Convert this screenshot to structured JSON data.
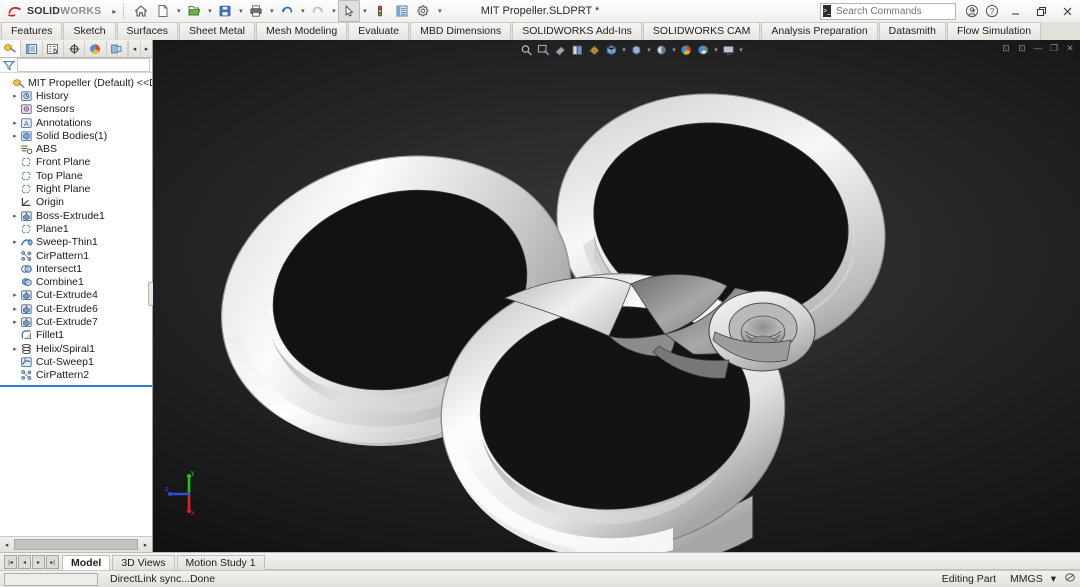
{
  "app": {
    "brand_ds": "3DS",
    "brand_name": "SOLIDWORKS",
    "brand_suffix": "WORKS",
    "document_title": "MIT Propeller.SLDPRT *"
  },
  "quick_access": [
    {
      "name": "home-icon",
      "label": "Home"
    },
    {
      "name": "new-document-icon",
      "label": "New"
    },
    {
      "name": "open-document-icon",
      "label": "Open"
    },
    {
      "name": "save-icon",
      "label": "Save"
    },
    {
      "name": "print-icon",
      "label": "Print"
    },
    {
      "name": "undo-icon",
      "label": "Undo"
    },
    {
      "name": "redo-icon",
      "label": "Redo"
    },
    {
      "name": "select-cursor-icon",
      "label": "Select"
    },
    {
      "name": "rebuild-icon",
      "label": "Rebuild"
    },
    {
      "name": "options-list-icon",
      "label": "Toggle Display"
    },
    {
      "name": "gear-icon",
      "label": "Options"
    }
  ],
  "search": {
    "placeholder": "Search Commands",
    "value": ""
  },
  "titlebar_right": [
    {
      "name": "account-icon",
      "label": "Account"
    },
    {
      "name": "help-icon",
      "label": "Help"
    },
    {
      "name": "minimize-button",
      "label": "Minimize"
    },
    {
      "name": "restore-button",
      "label": "Restore"
    },
    {
      "name": "close-button",
      "label": "Close"
    }
  ],
  "ribbon": {
    "tabs": [
      {
        "label": "Features",
        "active": false
      },
      {
        "label": "Sketch",
        "active": false
      },
      {
        "label": "Surfaces",
        "active": false
      },
      {
        "label": "Sheet Metal",
        "active": false
      },
      {
        "label": "Mesh Modeling",
        "active": false
      },
      {
        "label": "Evaluate",
        "active": false
      },
      {
        "label": "MBD Dimensions",
        "active": false
      },
      {
        "label": "SOLIDWORKS Add-Ins",
        "active": false
      },
      {
        "label": "SOLIDWORKS CAM",
        "active": false
      },
      {
        "label": "Analysis Preparation",
        "active": false
      },
      {
        "label": "Datasmith",
        "active": false
      },
      {
        "label": "Flow Simulation",
        "active": false
      }
    ]
  },
  "feature_manager": {
    "tabs": [
      {
        "name": "feature-manager-tab",
        "label": "FeatureManager Design Tree",
        "active": true
      },
      {
        "name": "property-manager-tab",
        "label": "PropertyManager",
        "active": false
      },
      {
        "name": "configuration-manager-tab",
        "label": "ConfigurationManager",
        "active": false
      },
      {
        "name": "dimxpert-manager-tab",
        "label": "DimXpertManager",
        "active": false
      },
      {
        "name": "display-manager-tab",
        "label": "DisplayManager",
        "active": false
      },
      {
        "name": "appearances-tab",
        "label": "Appearances",
        "active": false
      }
    ],
    "filter_placeholder": "",
    "tree": [
      {
        "label": "MIT Propeller (Default) <<Default>_",
        "icon": "part-icon",
        "indent": 0,
        "expandable": false,
        "root": true
      },
      {
        "label": "History",
        "icon": "history-icon",
        "indent": 1,
        "expandable": true
      },
      {
        "label": "Sensors",
        "icon": "sensors-icon",
        "indent": 1,
        "expandable": false
      },
      {
        "label": "Annotations",
        "icon": "annotations-icon",
        "indent": 1,
        "expandable": true
      },
      {
        "label": "Solid Bodies(1)",
        "icon": "solid-bodies-icon",
        "indent": 1,
        "expandable": true
      },
      {
        "label": "ABS",
        "icon": "material-icon",
        "indent": 1,
        "expandable": false
      },
      {
        "label": "Front Plane",
        "icon": "plane-icon",
        "indent": 1,
        "expandable": false
      },
      {
        "label": "Top Plane",
        "icon": "plane-icon",
        "indent": 1,
        "expandable": false
      },
      {
        "label": "Right Plane",
        "icon": "plane-icon",
        "indent": 1,
        "expandable": false
      },
      {
        "label": "Origin",
        "icon": "origin-icon",
        "indent": 1,
        "expandable": false
      },
      {
        "label": "Boss-Extrude1",
        "icon": "extrude-icon",
        "indent": 1,
        "expandable": true
      },
      {
        "label": "Plane1",
        "icon": "plane-icon",
        "indent": 1,
        "expandable": false
      },
      {
        "label": "Sweep-Thin1",
        "icon": "sweep-icon",
        "indent": 1,
        "expandable": true
      },
      {
        "label": "CirPattern1",
        "icon": "circular-pattern-icon",
        "indent": 1,
        "expandable": false
      },
      {
        "label": "Intersect1",
        "icon": "intersect-icon",
        "indent": 1,
        "expandable": false
      },
      {
        "label": "Combine1",
        "icon": "combine-icon",
        "indent": 1,
        "expandable": false
      },
      {
        "label": "Cut-Extrude4",
        "icon": "cut-extrude-icon",
        "indent": 1,
        "expandable": true
      },
      {
        "label": "Cut-Extrude6",
        "icon": "cut-extrude-icon",
        "indent": 1,
        "expandable": true
      },
      {
        "label": "Cut-Extrude7",
        "icon": "cut-extrude-icon",
        "indent": 1,
        "expandable": true
      },
      {
        "label": "Fillet1",
        "icon": "fillet-icon",
        "indent": 1,
        "expandable": false
      },
      {
        "label": "Helix/Spiral1",
        "icon": "helix-icon",
        "indent": 1,
        "expandable": true
      },
      {
        "label": "Cut-Sweep1",
        "icon": "cut-sweep-icon",
        "indent": 1,
        "expandable": false
      },
      {
        "label": "CirPattern2",
        "icon": "circular-pattern-icon",
        "indent": 1,
        "expandable": false
      }
    ]
  },
  "heads_up_toolbar": [
    {
      "name": "zoom-to-fit-icon",
      "label": "Zoom to Fit"
    },
    {
      "name": "zoom-to-area-icon",
      "label": "Zoom to Area"
    },
    {
      "name": "previous-view-icon",
      "label": "Previous View"
    },
    {
      "name": "section-view-icon",
      "label": "Section View"
    },
    {
      "name": "view-orientation-icon",
      "label": "View Orientation"
    },
    {
      "name": "display-style-icon",
      "label": "Display Style"
    },
    {
      "name": "hide-show-items-icon",
      "label": "Hide/Show Items"
    },
    {
      "name": "edit-appearance-icon",
      "label": "Edit Appearance"
    },
    {
      "name": "apply-scene-icon",
      "label": "Apply Scene"
    },
    {
      "name": "view-settings-icon",
      "label": "View Settings"
    }
  ],
  "document_window_buttons": [
    {
      "name": "pin-button",
      "label": "Pin"
    },
    {
      "name": "restore-doc-button",
      "label": "Restore"
    },
    {
      "name": "minimize-doc-button",
      "label": "Minimize"
    },
    {
      "name": "maximize-doc-button",
      "label": "Maximize"
    },
    {
      "name": "close-doc-button",
      "label": "Close"
    }
  ],
  "triad": {
    "x_label": "x",
    "y_label": "y",
    "z_label": "z",
    "x_color": "#2b4fd8",
    "y_color": "#22c022",
    "z_color": "#e02020"
  },
  "bottom_tabs": [
    {
      "label": "Model",
      "active": true
    },
    {
      "label": "3D Views",
      "active": false
    },
    {
      "label": "Motion Study 1",
      "active": false
    }
  ],
  "status_bar": {
    "message": "DirectLink sync...Done",
    "edit_mode": "Editing Part",
    "units": "MMGS",
    "units_arrow": "▾"
  },
  "colors": {
    "brand_red": "#cf2127",
    "accent_blue": "#2a7fd4",
    "panel_bg": "#ffffff",
    "viewport_bg": "#1a1a1a",
    "model_material": "#f2f2f2"
  }
}
